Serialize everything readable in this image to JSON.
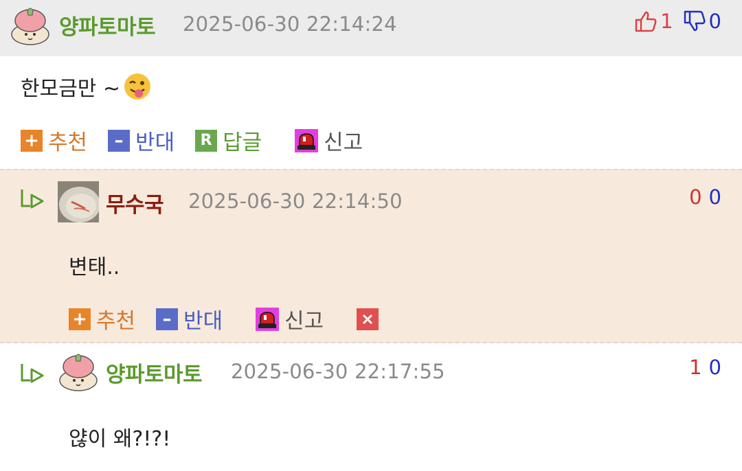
{
  "comments": [
    {
      "username": "양파토마토",
      "timestamp": "2025-06-30 22:14:24",
      "upvotes": "1",
      "downvotes": "0",
      "content": "한모금만 ~",
      "actions": {
        "recommend": "추천",
        "oppose": "반대",
        "reply": "답글",
        "report": "신고"
      }
    },
    {
      "username": "무수국",
      "timestamp": "2025-06-30 22:14:50",
      "upvotes": "0",
      "downvotes": "0",
      "content": "변태..",
      "actions": {
        "recommend": "추천",
        "oppose": "반대",
        "report": "신고"
      }
    },
    {
      "username": "양파토마토",
      "timestamp": "2025-06-30 22:17:55",
      "upvotes": "1",
      "downvotes": "0",
      "content": "얂이 왜?!?!"
    }
  ],
  "colors": {
    "username_green": "#5a9a2d",
    "username_maroon": "#8b1c10",
    "upvote": "#e04040",
    "downvote": "#2030c0",
    "recommend": "#e8842a",
    "oppose": "#5a6cc8",
    "reply": "#6aa84f",
    "reply_bg": "#f7eadc"
  },
  "icons": [
    "thumbs-up-icon",
    "thumbs-down-icon",
    "plus-icon",
    "minus-icon",
    "reply-r-icon",
    "siren-icon",
    "delete-x-icon",
    "reply-arrow-icon"
  ]
}
